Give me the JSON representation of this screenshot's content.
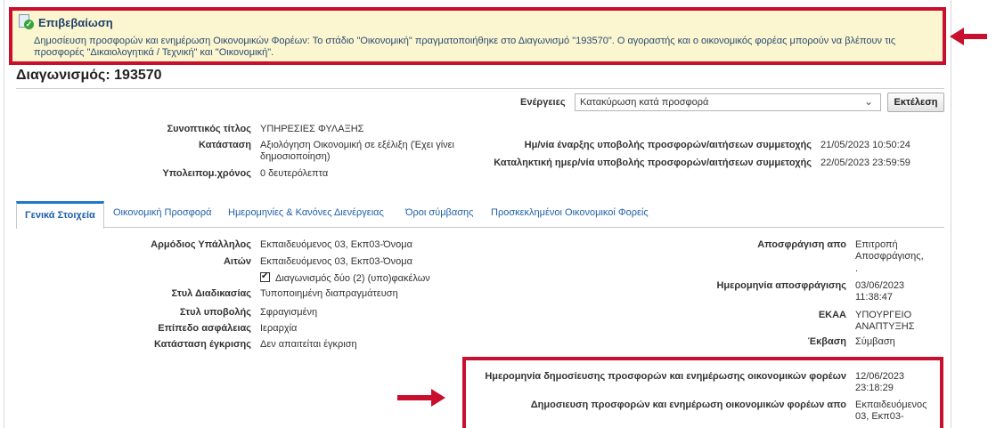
{
  "confirmation": {
    "title": "Επιβεβαίωση",
    "message": "Δημοσίευση προσφορών και ενημέρωση Οικονομικών Φορέων: Το στάδιο \"Οικονομική\" πραγματοποιήθηκε στο Διαγωνισμό \"193570\". Ο αγοραστής και ο οικονομικός φορέας μπορούν να βλέπουν τις προσφορές \"Δικαιολογητικά / Τεχνική\" και \"Οικονομική\"."
  },
  "page": {
    "title": "Διαγωνισμός: 193570"
  },
  "actions": {
    "label": "Ενέργειες",
    "selected": "Κατακύρωση κατά προσφορά",
    "run_label": "Εκτέλεση"
  },
  "summary": {
    "short_title_label": "Συνοπτικός τίτλος",
    "short_title": "ΥΠΗΡΕΣΙΕΣ ΦΥΛΑΞΗΣ",
    "status_label": "Κατάσταση",
    "status": "Αξιολόγηση Οικονομική σε εξέλιξη (Έχει γίνει δημοσιοποίηση)",
    "remaining_label": "Υπολειπομ.χρόνος",
    "remaining": "0 δευτερόλεπτα",
    "start_label": "Ημ/νία έναρξης υποβολής προσφορών/αιτήσεων συμμετοχής",
    "start": "21/05/2023 10:50:24",
    "end_label": "Καταληκτική ημερ/νία υποβολής προσφορών/αιτήσεων συμμετοχής",
    "end": "22/05/2023 23:59:59"
  },
  "tabs": [
    {
      "label": "Γενικά Στοιχεία"
    },
    {
      "label": "Οικονομική Προσφορά"
    },
    {
      "label": "Ημερομηνίες & Κανόνες Διενέργειας"
    },
    {
      "label": "Όροι σύμβασης"
    },
    {
      "label": "Προσκεκλημένοι Οικονομικοί Φορείς"
    }
  ],
  "general": {
    "officer_label": "Αρμόδιος Υπάλληλος",
    "officer": "Εκπαιδευόμενος 03, Εκπ03-Όνομα",
    "requester_label": "Αιτών",
    "requester": "Εκπαιδευόμενος 03, Εκπ03-Όνομα",
    "two_envelope_label": "Διαγωνισμός δύο (2) (υπο)φακέλων",
    "procedure_label": "Στυλ Διαδικασίας",
    "procedure": "Τυποποιημένη διαπραγμάτευση",
    "submission_label": "Στυλ υποβολής",
    "submission": "Σφραγισμένη",
    "security_label": "Επίπεδο ασφάλειας",
    "security": "Ιεραρχία",
    "approval_label": "Κατάσταση έγκρισης",
    "approval": "Δεν απαιτείται έγκριση",
    "unsealed_by_label": "Αποσφράγιση απο",
    "unsealed_by": "Επιτροπή Αποσφράγισης,",
    "unsealed_by_extra": ".",
    "unseal_date_label": "Ημερομηνία αποσφράγισης",
    "unseal_date": "03/06/2023 11:38:47",
    "ekaa_label": "ΕΚΑΑ",
    "ekaa": "ΥΠΟΥΡΓΕΙΟ ΑΝΑΠΤΥΞΗΣ",
    "outcome_label": "Έκβαση",
    "outcome": "Σύμβαση",
    "publish_date_label": "Ημερομηνία δημοσίευσης προσφορών και ενημέρωσης οικονομικών φορέων",
    "publish_date": "12/06/2023 23:18:29",
    "publish_by_label": "Δημοσιευση προσφορών και ενημέρωση οικονομικών φορέων απο",
    "publish_by": "Εκπαιδευόμενος 03, Εκπ03-"
  },
  "colors": {
    "highlight": "#c8102e",
    "banner_bg": "#fbf6cf",
    "link": "#1f5fa8"
  }
}
